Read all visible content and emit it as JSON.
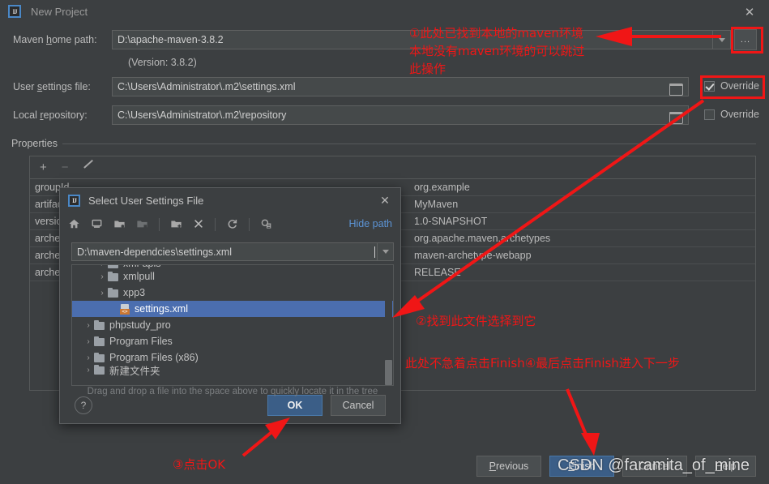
{
  "window": {
    "title": "New Project",
    "logo_text": "IJ",
    "close_icon": "✕"
  },
  "form": {
    "maven_home_label_pre": "Maven ",
    "maven_home_label_u": "h",
    "maven_home_label_post": "ome path:",
    "maven_home_value": "D:\\apache-maven-3.8.2",
    "version_note": "(Version: 3.8.2)",
    "user_settings_label_pre": "User ",
    "user_settings_label_u": "s",
    "user_settings_label_post": "ettings file:",
    "user_settings_value": "C:\\Users\\Administrator\\.m2\\settings.xml",
    "local_repo_label_pre": "Local ",
    "local_repo_label_u": "r",
    "local_repo_label_post": "epository:",
    "local_repo_value": "C:\\Users\\Administrator\\.m2\\repository",
    "browse_button_label": "...",
    "override_label": "Override",
    "override_settings_checked": true,
    "override_repo_checked": false
  },
  "properties": {
    "group_title": "Properties",
    "toolbar": {
      "add": "+",
      "remove": "−",
      "edit": "edit-pencil"
    },
    "rows": [
      {
        "key": "groupId",
        "value": "org.example"
      },
      {
        "key": "artifactId",
        "value": "MyMaven"
      },
      {
        "key": "version",
        "value": "1.0-SNAPSHOT"
      },
      {
        "key": "archetypeGroupId",
        "value": "org.apache.maven.archetypes"
      },
      {
        "key": "archetypeArtifactId",
        "value": "maven-archetype-webapp"
      },
      {
        "key": "archetypeVersion",
        "value": "RELEASE"
      }
    ]
  },
  "wizard_buttons": {
    "previous_pre": "",
    "previous_u": "P",
    "previous_post": "revious",
    "finish_pre": "",
    "finish_u": "F",
    "finish_post": "inish",
    "cancel": "Cancel",
    "help_pre": "",
    "help_u": "H",
    "help_post": "elp"
  },
  "modal": {
    "title": "Select User Settings File",
    "logo_text": "IJ",
    "close_icon": "✕",
    "toolbar_icons": [
      "home-icon",
      "desktop-icon",
      "project-folder-icon",
      "module-folder-icon",
      "new-folder-icon",
      "delete-icon",
      "refresh-icon",
      "show-hidden-icon"
    ],
    "hide_path_label": "Hide path",
    "path_value": "D:\\maven-dependcies\\settings.xml",
    "tree": [
      {
        "label": "xmi-apis",
        "type": "folder",
        "indent": 1,
        "selected": false,
        "clipped_top": true
      },
      {
        "label": "xmlpull",
        "type": "folder",
        "indent": 1,
        "selected": false
      },
      {
        "label": "xpp3",
        "type": "folder",
        "indent": 1,
        "selected": false
      },
      {
        "label": "settings.xml",
        "type": "xml",
        "indent": 2,
        "selected": true
      },
      {
        "label": "phpstudy_pro",
        "type": "folder",
        "indent": 0,
        "selected": false
      },
      {
        "label": "Program Files",
        "type": "folder",
        "indent": 0,
        "selected": false
      },
      {
        "label": "Program Files (x86)",
        "type": "folder",
        "indent": 0,
        "selected": false
      },
      {
        "label": "新建文件夹",
        "type": "folder",
        "indent": 0,
        "selected": false,
        "clipped_bottom": true
      }
    ],
    "drag_hint": "Drag and drop a file into the space above to quickly locate it in the tree",
    "help_icon": "?",
    "ok_label": "OK",
    "cancel_label": "Cancel"
  },
  "annotations": {
    "accent_color": "#f01616",
    "note1_line1": "①此处已找到本地的maven环境",
    "note1_line2": "本地没有maven环境的可以跳过",
    "note1_line3": "此操作",
    "note2": "②找到此文件选择到它",
    "note3": "此处不急着点击Finish④最后点击Finish进入下一步",
    "note4": "③点击OK"
  },
  "watermark": {
    "text": "CSDN @faramita_of_mine"
  }
}
